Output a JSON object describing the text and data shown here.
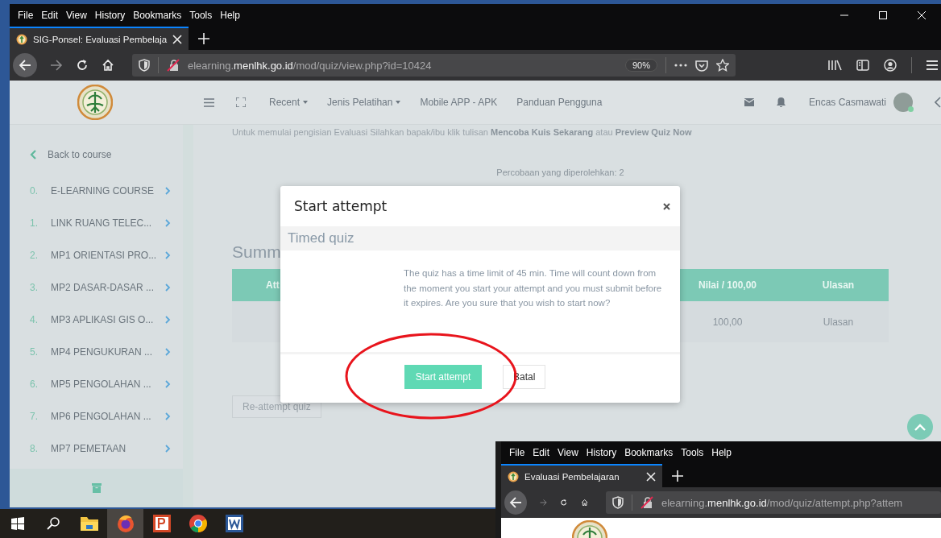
{
  "main_window": {
    "menu": [
      "File",
      "Edit",
      "View",
      "History",
      "Bookmarks",
      "Tools",
      "Help"
    ],
    "tabs": [
      {
        "title": "SIG-Ponsel: Evaluasi Pembelaja",
        "selected": true
      }
    ],
    "address_bar": {
      "url": "elearning.**menlhk.go.id**/mod/quiz/view.php?id=10424",
      "zoom": "90%"
    },
    "site_header": {
      "links": [
        {
          "label": "Recent",
          "dropdown": true
        },
        {
          "label": "Jenis Pelatihan",
          "dropdown": true
        },
        {
          "label": "Mobile APP - APK",
          "dropdown": false
        },
        {
          "label": "Panduan Pengguna",
          "dropdown": false
        }
      ],
      "user_name": "Encas Casmawati"
    },
    "sidebar": {
      "back_link": "Back to course",
      "items": [
        {
          "number": "0.",
          "label": "E-LEARNING COURSE"
        },
        {
          "number": "1.",
          "label": "LINK RUANG TELEC..."
        },
        {
          "number": "2.",
          "label": "MP1 ORIENTASI PRO..."
        },
        {
          "number": "3.",
          "label": "MP2 DASAR-DASAR ..."
        },
        {
          "number": "4.",
          "label": "MP3 APLIKASI GIS O..."
        },
        {
          "number": "5.",
          "label": "MP4 PENGUKURAN ..."
        },
        {
          "number": "6.",
          "label": "MP5 PENGOLAHAN ..."
        },
        {
          "number": "7.",
          "label": "MP6 PENGOLAHAN ..."
        },
        {
          "number": "8.",
          "label": "MP7 PEMETAAN"
        }
      ]
    },
    "content": {
      "intro": "Untuk memulai pengisian Evaluasi Silahkan bapak/ibu klik tulisan **Mencoba Kuis Sekarang** atau **Preview Quiz Now**",
      "attempts_allowed": "Percobaan yang diperolehkan: 2",
      "summary_heading": "Summ",
      "table": {
        "columns": [
          "Att",
          "Nilai / 100,00",
          "Ulasan"
        ],
        "rows": [
          [
            "",
            "100,00",
            "Ulasan"
          ]
        ]
      },
      "reattempt_button": "Re-attempt quiz"
    },
    "modal": {
      "title": "Start attempt",
      "section": "Timed quiz",
      "message": "The quiz has a time limit of 45 min. Time will count down from the moment you start your attempt and you must submit before it expires. Are you sure that you wish to start now?",
      "buttons": [
        {
          "label": "Start attempt",
          "kind": "primary"
        },
        {
          "label": "Batal",
          "kind": "secondary"
        }
      ]
    }
  },
  "second_window": {
    "menu": [
      "File",
      "Edit",
      "View",
      "History",
      "Bookmarks",
      "Tools",
      "Help"
    ],
    "tabs": [
      {
        "title": "Evaluasi Pembelajaran",
        "selected": true
      }
    ],
    "address_bar": {
      "url": "elearning.**menlhk.go.id**/mod/quiz/attempt.php?attem"
    }
  },
  "taskbar": {
    "apps": [
      {
        "kind": "file-explorer",
        "active": false
      },
      {
        "kind": "firefox",
        "active": true
      },
      {
        "kind": "powerpoint",
        "active": false
      },
      {
        "kind": "chrome",
        "active": false
      },
      {
        "kind": "word",
        "active": false
      }
    ]
  }
}
